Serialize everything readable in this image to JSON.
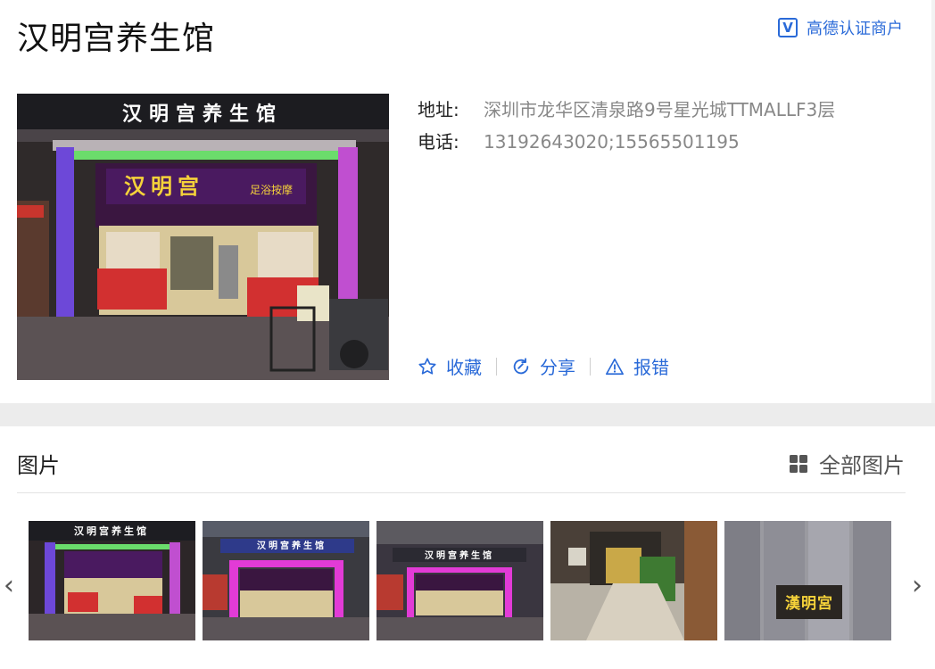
{
  "shop": {
    "name": "汉明宫养生馆",
    "cert_badge": "V",
    "cert_label": "高德认证商户"
  },
  "photo": {
    "sign_text": "汉明宫养生馆",
    "inner_sign": "汉明宫",
    "inner_sign_sub": "足浴按摩"
  },
  "info": {
    "address_label": "地址:",
    "address_value": "深圳市龙华区清泉路9号星光城TTMALLF3层",
    "phone_label": "电话:",
    "phone_value": "13192643020;15565501195"
  },
  "actions": {
    "favorite": "收藏",
    "share": "分享",
    "report": "报错"
  },
  "gallery": {
    "title": "图片",
    "all_label": "全部图片",
    "thumb_signs": [
      "汉明宫养生馆",
      "汉明宫养生馆",
      "汉明宫养生馆",
      "",
      "漢明宮"
    ]
  },
  "colors": {
    "accent": "#2a6ad8",
    "neon_pink": "#e23bd6",
    "sign_gold": "#f5d23a"
  }
}
